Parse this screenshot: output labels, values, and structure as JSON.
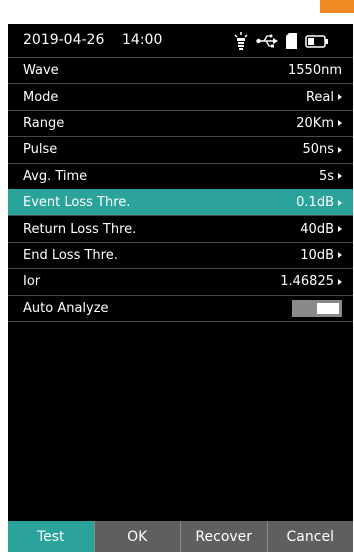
{
  "status": {
    "date": "2019-04-26",
    "time": "14:00",
    "icons": [
      "lamp-icon",
      "usb-icon",
      "sd-card-icon",
      "battery-icon"
    ]
  },
  "settings": [
    {
      "label": "Wave",
      "value": "1550nm",
      "arrow": false
    },
    {
      "label": "Mode",
      "value": "Real",
      "arrow": true
    },
    {
      "label": "Range",
      "value": "20Km",
      "arrow": true
    },
    {
      "label": "Pulse",
      "value": "50ns",
      "arrow": true
    },
    {
      "label": "Avg. Time",
      "value": "5s",
      "arrow": true
    },
    {
      "label": "Event Loss Thre.",
      "value": "0.1dB",
      "arrow": true
    },
    {
      "label": "Return Loss Thre.",
      "value": "40dB",
      "arrow": true
    },
    {
      "label": "End Loss Thre.",
      "value": "10dB",
      "arrow": true
    },
    {
      "label": "Ior",
      "value": "1.46825",
      "arrow": true
    }
  ],
  "auto_analyze": {
    "label": "Auto Analyze",
    "on": true
  },
  "buttons": {
    "test": "Test",
    "ok": "OK",
    "recover": "Recover",
    "cancel": "Cancel"
  },
  "colors": {
    "accent": "#2aa39a",
    "background": "#000000",
    "button": "#5f5f5f",
    "corner_tab": "#f08a24"
  }
}
